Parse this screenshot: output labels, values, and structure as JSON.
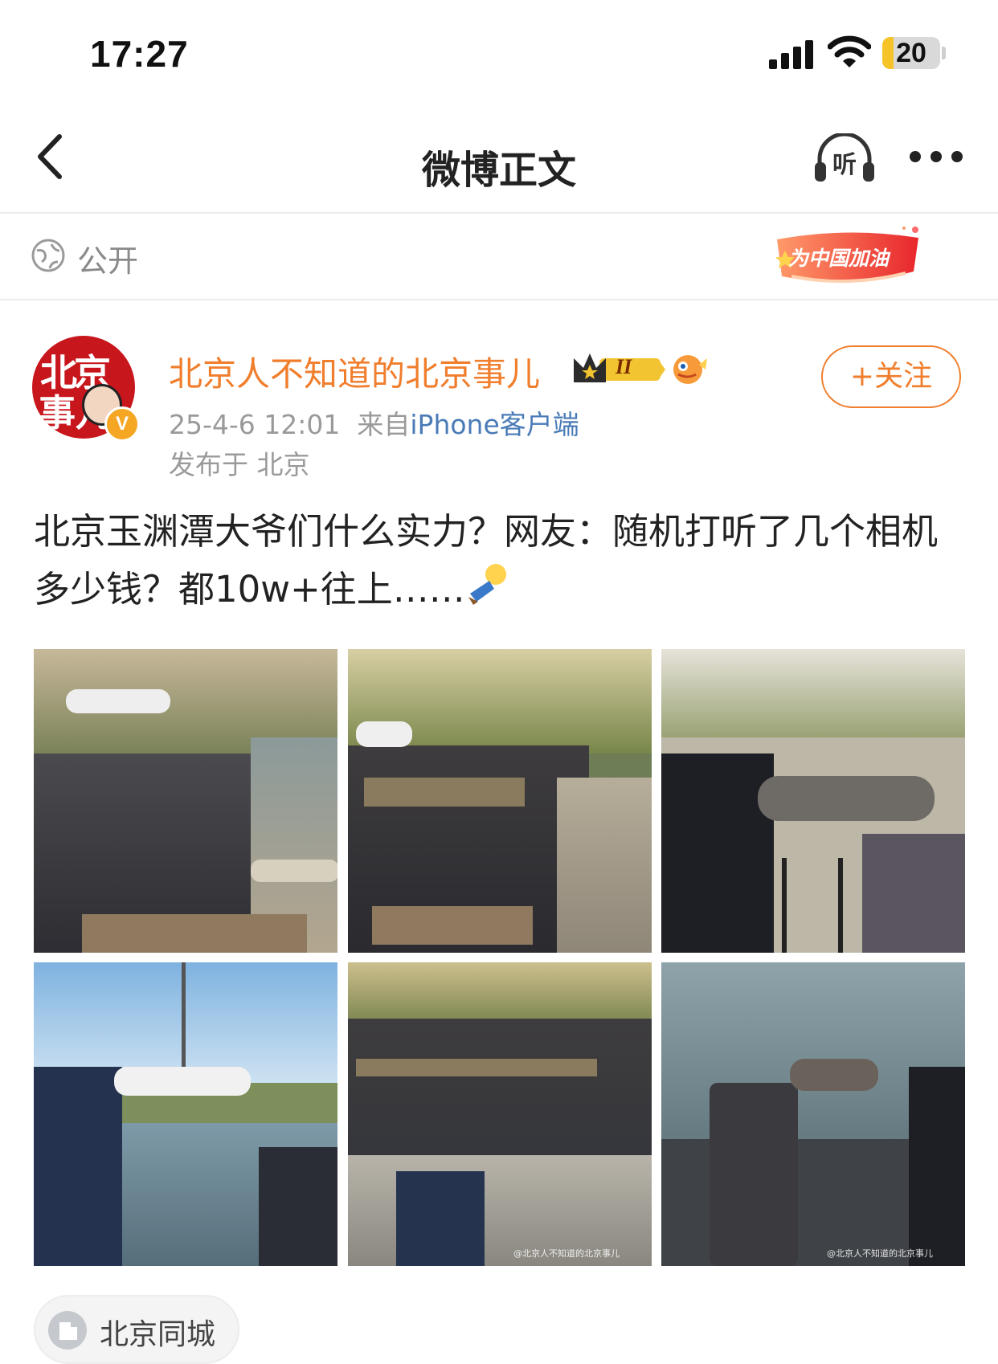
{
  "status_bar": {
    "time": "17:27",
    "battery": "20",
    "battery_level": 0.2
  },
  "nav": {
    "title": "微博正文",
    "listen_label": "听",
    "back_icon": "chevron-left-icon",
    "more_icon": "ellipsis-icon"
  },
  "visibility": {
    "label": "公开",
    "icon": "globe-icon",
    "badge_text": "为中国加油"
  },
  "post": {
    "author": "北京人不知道的北京事儿",
    "avatar_text_line1": "北京",
    "avatar_text_line2": "事儿",
    "verified_badge": "V",
    "level_badge": "II",
    "timestamp": "25-4-6 12:01",
    "source_prefix": "来自",
    "source": "iPhone客户端",
    "location": "发布于 北京",
    "follow_label": "+关注",
    "text": "北京玉渊潭大爷们什么实力？网友：随机打听了几个相机多少钱？都10w+往上……",
    "images": [
      {
        "name": "photo-1",
        "desc": "photographers with telephoto lenses along lake steps"
      },
      {
        "name": "photo-2",
        "desc": "rows of photographers on stone steps"
      },
      {
        "name": "photo-3",
        "desc": "man with camouflage lens on tripod"
      },
      {
        "name": "photo-4",
        "desc": "photographer with white lens by lake"
      },
      {
        "name": "photo-5",
        "desc": "crowd of photographers on steps"
      },
      {
        "name": "photo-6",
        "desc": "photographer with camouflage lens facing water"
      }
    ],
    "watermark": "@北京人不知道的北京事儿"
  },
  "topic": {
    "label": "北京同城"
  },
  "colors": {
    "accent": "#f07e2d",
    "link": "#4a7bb7",
    "muted": "#9a9a9a"
  }
}
